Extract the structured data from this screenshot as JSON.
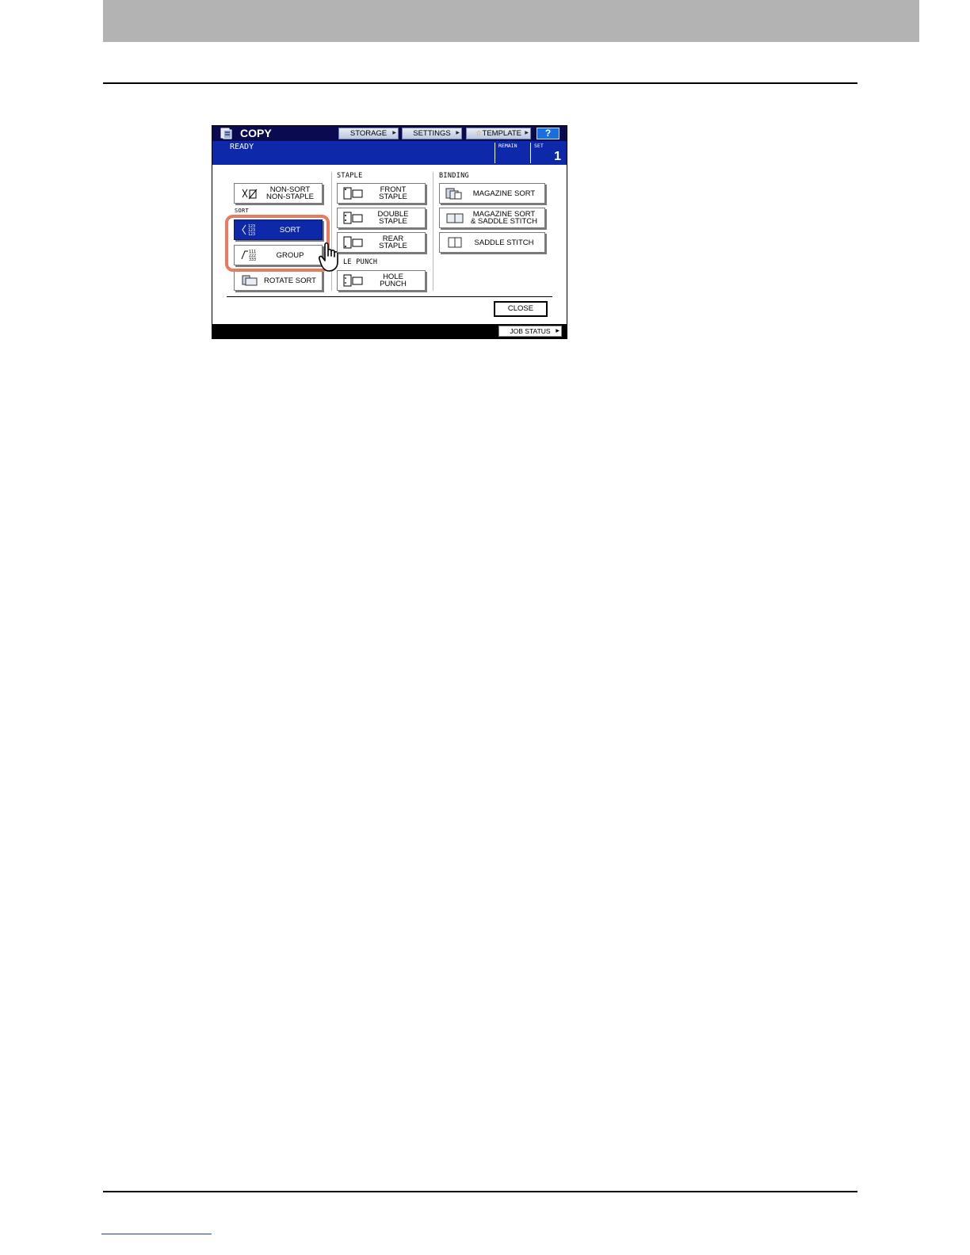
{
  "window": {
    "title": "COPY",
    "status": "READY",
    "remain_label": "REMAIN",
    "set_label": "SET",
    "set_value": "1"
  },
  "toolbar": {
    "storage": "STORAGE",
    "settings": "SETTINGS",
    "template": "TEMPLATE",
    "help": "?"
  },
  "sections": {
    "sort": "SORT",
    "staple": "STAPLE",
    "hole_punch": "LE PUNCH",
    "binding": "BINDING"
  },
  "sort_buttons": {
    "non_sort": "NON-SORT\nNON-STAPLE",
    "sort": "SORT",
    "group": "GROUP",
    "rotate_sort": "ROTATE SORT"
  },
  "staple_buttons": {
    "front": "FRONT\nSTAPLE",
    "double": "DOUBLE\nSTAPLE",
    "rear": "REAR\nSTAPLE",
    "hole_punch": "HOLE\nPUNCH"
  },
  "binding_buttons": {
    "magazine_sort": "MAGAZINE SORT",
    "magazine_saddle": "MAGAZINE SORT\n& SADDLE STITCH",
    "saddle_stitch": "SADDLE STITCH"
  },
  "footer": {
    "close": "CLOSE",
    "job_status": "JOB STATUS"
  },
  "colors": {
    "title_bar": "#0a0a50",
    "status_bar": "#0d28a8",
    "selected_button": "#0d28a8",
    "highlight": "#e87a5d",
    "header_band": "#b3b3b3"
  }
}
